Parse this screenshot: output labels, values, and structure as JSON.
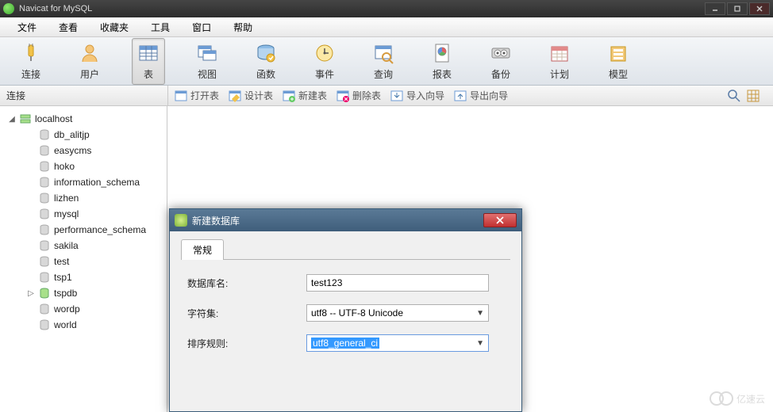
{
  "title": "Navicat for MySQL",
  "menu": {
    "file": "文件",
    "view": "查看",
    "favorites": "收藏夹",
    "tools": "工具",
    "window": "窗口",
    "help": "帮助"
  },
  "toolbar": {
    "connection": "连接",
    "user": "用户",
    "table": "表",
    "view": "视图",
    "function": "函数",
    "event": "事件",
    "query": "查询",
    "report": "报表",
    "backup": "备份",
    "schedule": "计划",
    "model": "模型"
  },
  "connbar_label": "连接",
  "subtoolbar": {
    "open": "打开表",
    "design": "设计表",
    "new": "新建表",
    "delete": "删除表",
    "import": "导入向导",
    "export": "导出向导"
  },
  "tree": {
    "root": "localhost",
    "dbs": [
      "db_alitjp",
      "easycms",
      "hoko",
      "information_schema",
      "lizhen",
      "mysql",
      "performance_schema",
      "sakila",
      "test",
      "tsp1",
      "tspdb",
      "wordp",
      "world"
    ],
    "expandable_index": 10
  },
  "dialog": {
    "title": "新建数据库",
    "tab": "常规",
    "fields": {
      "dbname_label": "数据库名:",
      "dbname_value": "test123",
      "charset_label": "字符集:",
      "charset_value": "utf8 -- UTF-8 Unicode",
      "collation_label": "排序规则:",
      "collation_value": "utf8_general_ci"
    }
  },
  "watermark": "亿速云"
}
